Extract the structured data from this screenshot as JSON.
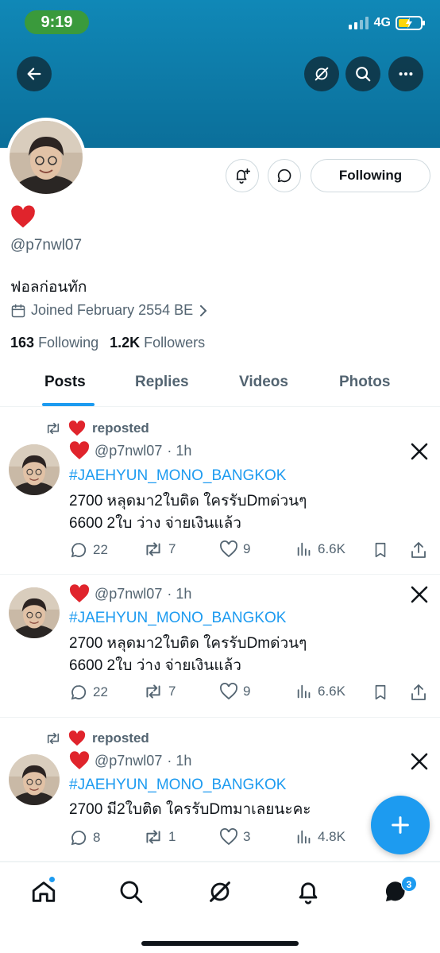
{
  "status_bar": {
    "time": "9:19",
    "network": "4G"
  },
  "profile": {
    "display_name_emoji": "❤️",
    "handle": "@p7nwl07",
    "bio": "ฟอลก่อนทัก",
    "joined": "Joined February 2554 BE",
    "following_count": "163",
    "following_label": "Following",
    "followers_count": "1.2K",
    "followers_label": "Followers",
    "follow_button_label": "Following"
  },
  "tabs": [
    "Posts",
    "Replies",
    "Videos",
    "Photos"
  ],
  "posts": [
    {
      "repost_label": "reposted",
      "author_handle": "@p7nwl07",
      "time": "· 1h",
      "hashtag": "#JAEHYUN_MONO_BANGKOK",
      "line1": "2700 หลุดมา2ใบติด ใครรับDmด่วนๆ",
      "line2": "6600 2ใบ ว่าง จ่ายเงินแล้ว",
      "replies": "22",
      "reposts": "7",
      "likes": "9",
      "views": "6.6K"
    },
    {
      "author_handle": "@p7nwl07",
      "time": "· 1h",
      "hashtag": "#JAEHYUN_MONO_BANGKOK",
      "line1": "2700 หลุดมา2ใบติด ใครรับDmด่วนๆ",
      "line2": "6600 2ใบ ว่าง จ่ายเงินแล้ว",
      "replies": "22",
      "reposts": "7",
      "likes": "9",
      "views": "6.6K"
    },
    {
      "repost_label": "reposted",
      "author_handle": "@p7nwl07",
      "time": "· 1h",
      "hashtag": "#JAEHYUN_MONO_BANGKOK",
      "line1": "2700 มี2ใบติด ใครรับDmมาเลยนะคะ",
      "replies": "8",
      "reposts": "1",
      "likes": "3",
      "views": "4.8K"
    }
  ],
  "bottom_nav": {
    "messages_badge": "3"
  },
  "colors": {
    "accent": "#1d9bf0",
    "banner": "#0b6f9a",
    "status_pill": "#3a9a3c"
  }
}
